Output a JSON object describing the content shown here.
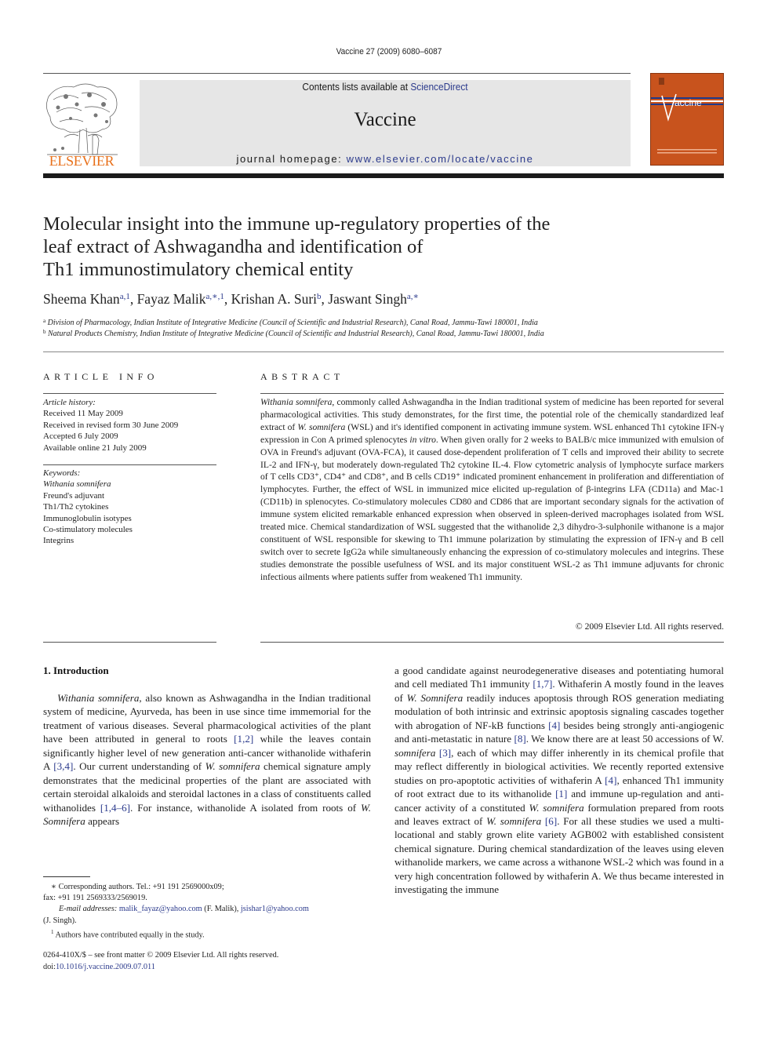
{
  "running_head": "Vaccine 27 (2009) 6080–6087",
  "banner": {
    "contents_prefix": "Contents lists available at ",
    "contents_link": "ScienceDirect",
    "journal_name": "Vaccine",
    "homepage_prefix": "journal homepage: ",
    "homepage_link": "www.elsevier.com/locate/vaccine"
  },
  "publisher_logo": {
    "icon": "elsevier-tree-logo",
    "wordmark": "ELSEVIER",
    "color": "#e8701a"
  },
  "cover": {
    "icon": "journal-cover-thumbnail",
    "title": "Vaccine",
    "color": "#c8531d"
  },
  "article": {
    "title_lines": [
      "Molecular insight into the immune up-regulatory properties of the",
      "leaf extract of Ashwagandha and identification of",
      "Th1 immunostimulatory chemical entity"
    ],
    "authors": [
      {
        "name": "Sheema Khan",
        "marks": "a,1",
        "sep": ", "
      },
      {
        "name": "Fayaz Malik",
        "marks": "a,∗,1",
        "sep": ", "
      },
      {
        "name": "Krishan A. Suri",
        "marks": "b",
        "sep": ", "
      },
      {
        "name": "Jaswant Singh",
        "marks": "a,∗",
        "sep": ""
      }
    ],
    "affiliations": [
      {
        "mark": "a",
        "text": "Division of Pharmacology, Indian Institute of Integrative Medicine (Council of Scientific and Industrial Research), Canal Road, Jammu-Tawi 180001, India"
      },
      {
        "mark": "b",
        "text": "Natural Products Chemistry, Indian Institute of Integrative Medicine (Council of Scientific and Industrial Research), Canal Road, Jammu-Tawi 180001, India"
      }
    ]
  },
  "article_info": {
    "label": "ARTICLE INFO",
    "history_label": "Article history:",
    "history": [
      "Received 11 May 2009",
      "Received in revised form 30 June 2009",
      "Accepted 6 July 2009",
      "Available online 21 July 2009"
    ],
    "keywords_label": "Keywords:",
    "keywords": [
      "Withania somnifera",
      "Freund's adjuvant",
      "Th1/Th2 cytokines",
      "Immunoglobulin isotypes",
      "Co-stimulatory molecules",
      "Integrins"
    ]
  },
  "abstract": {
    "label": "ABSTRACT",
    "segments": [
      {
        "t": "Withania somnifera",
        "i": true
      },
      {
        "t": ", commonly called Ashwagandha in the Indian traditional system of medicine has been reported for several pharmacological activities. This study demonstrates, for the first time, the potential role of the chemically standardized leaf extract of "
      },
      {
        "t": "W. somnifera",
        "i": true
      },
      {
        "t": " (WSL) and it's identified component in activating immune system. WSL enhanced Th1 cytokine IFN-γ expression in Con A primed splenocytes "
      },
      {
        "t": "in vitro",
        "i": true
      },
      {
        "t": ". When given orally for 2 weeks to BALB/c mice immunized with emulsion of OVA in Freund's adjuvant (OVA-FCA), it caused dose-dependent proliferation of T cells and improved their ability to secrete IL-2 and IFN-γ, but moderately down-regulated Th2 cytokine IL-4. Flow cytometric analysis of lymphocyte surface markers of T cells CD3⁺, CD4⁺ and CD8⁺, and B cells CD19⁺ indicated prominent enhancement in proliferation and differentiation of lymphocytes. Further, the effect of WSL in immunized mice elicited up-regulation of β-integrins LFA (CD11a) and Mac-1 (CD11b) in splenocytes. Co-stimulatory molecules CD80 and CD86 that are important secondary signals for the activation of immune system elicited remarkable enhanced expression when observed in spleen-derived macrophages isolated from WSL treated mice. Chemical standardization of WSL suggested that the withanolide 2,3 dihydro-3-sulphonile withanone is a major constituent of WSL responsible for skewing to Th1 immune polarization by stimulating the expression of IFN-γ and B cell switch over to secrete IgG2a while simultaneously enhancing the expression of co-stimulatory molecules and integrins. These studies demonstrate the possible usefulness of WSL and its major constituent WSL-2 as Th1 immune adjuvants for chronic infectious ailments where patients suffer from weakened Th1 immunity."
      }
    ],
    "copyright": "© 2009 Elsevier Ltd. All rights reserved."
  },
  "introduction": {
    "heading": "1.  Introduction",
    "left_segments": [
      {
        "t": "Withania somnifera",
        "i": true
      },
      {
        "t": ", also known as Ashwagandha in the Indian traditional system of medicine, Ayurveda, has been in use since time immemorial for the treatment of various diseases. Several pharmacological activities of the plant have been attributed in general to roots "
      },
      {
        "t": "[1,2]",
        "c": true
      },
      {
        "t": " while the leaves contain significantly higher level of new generation anti-cancer withanolide withaferin A "
      },
      {
        "t": "[3,4]",
        "c": true
      },
      {
        "t": ". Our current understanding of "
      },
      {
        "t": "W. somnifera",
        "i": true
      },
      {
        "t": " chemical signature amply demonstrates that the medicinal properties of the plant are associated with certain steroidal alkaloids and steroidal lactones in a class of constituents called withanolides "
      },
      {
        "t": "[1,4–6]",
        "c": true
      },
      {
        "t": ". For instance, withanolide A isolated from roots of "
      },
      {
        "t": "W. Somnifera",
        "i": true
      },
      {
        "t": " appears"
      }
    ],
    "right_segments": [
      {
        "t": "a good candidate against neurodegenerative diseases and potentiating humoral and cell mediated Th1 immunity "
      },
      {
        "t": "[1,7]",
        "c": true
      },
      {
        "t": ". Withaferin A mostly found in the leaves of "
      },
      {
        "t": "W. Somnifera",
        "i": true
      },
      {
        "t": " readily induces apoptosis through ROS generation mediating modulation of both intrinsic and extrinsic apoptosis signaling cascades together with abrogation of NF-kB functions "
      },
      {
        "t": "[4]",
        "c": true
      },
      {
        "t": " besides being strongly anti-angiogenic and anti-metastatic in nature "
      },
      {
        "t": "[8]",
        "c": true
      },
      {
        "t": ". We know there are at least 50 accessions of W. "
      },
      {
        "t": "somnifera",
        "i": true
      },
      {
        "t": " "
      },
      {
        "t": "[3]",
        "c": true
      },
      {
        "t": ", each of which may differ inherently in its chemical profile that may reflect differently in biological activities. We recently reported extensive studies on pro-apoptotic activities of withaferin A "
      },
      {
        "t": "[4]",
        "c": true
      },
      {
        "t": ", enhanced Th1 immunity of root extract due to its withanolide "
      },
      {
        "t": "[1]",
        "c": true
      },
      {
        "t": " and immune up-regulation and anti-cancer activity of a constituted "
      },
      {
        "t": "W. somnifera",
        "i": true
      },
      {
        "t": " formulation prepared from roots and leaves extract of "
      },
      {
        "t": "W. somnifera",
        "i": true
      },
      {
        "t": " "
      },
      {
        "t": "[6]",
        "c": true
      },
      {
        "t": ". For all these studies we used a multi-locational and stably grown elite variety AGB002 with established consistent chemical signature. During chemical standardization of the leaves using eleven withanolide markers, we came across a withanone WSL-2 which was found in a very high concentration followed by withaferin A. We thus became interested in investigating the immune"
      }
    ]
  },
  "footnotes": {
    "corresponding": "∗  Corresponding authors. Tel.: +91 191 2569000x09;",
    "fax": "fax: +91 191 2569333/2569019.",
    "email_label": "E-mail addresses:",
    "email1": "malik_fayaz@yahoo.com",
    "email1_owner": " (F. Malik), ",
    "email2": "jsishar1@yahoo.com",
    "email2_owner": "(J. Singh).",
    "equal_mark": "1",
    "equal_text": " Authors have contributed equally in the study."
  },
  "front_matter": {
    "issn_line": "0264-410X/$ – see front matter © 2009 Elsevier Ltd. All rights reserved.",
    "doi_prefix": "doi:",
    "doi": "10.1016/j.vaccine.2009.07.011"
  }
}
